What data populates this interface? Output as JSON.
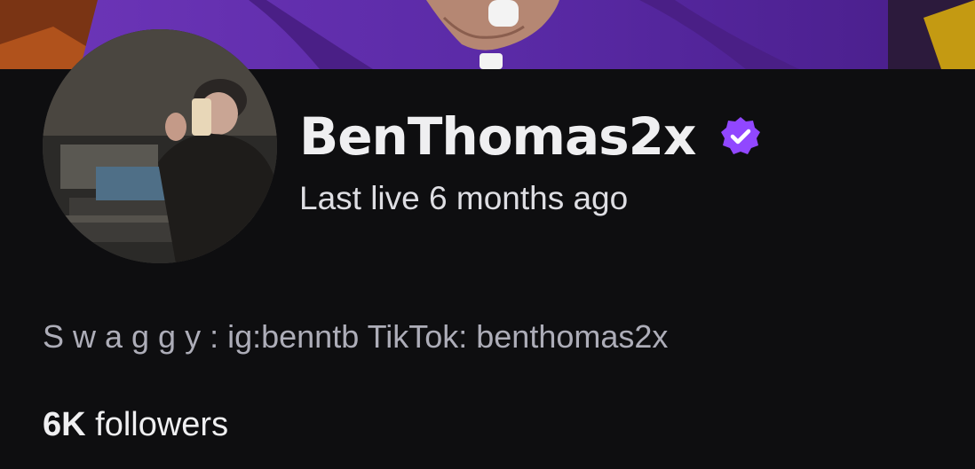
{
  "channel": {
    "name": "BenThomas2x",
    "verified": true,
    "last_live": "Last live 6 months ago",
    "bio": "S w a g g y : ig:benntb TikTok: benthomas2x",
    "followers_count": "6K",
    "followers_label": "followers"
  },
  "colors": {
    "background": "#0e0e10",
    "badge": "#9147ff",
    "text_primary": "#efeff1",
    "text_secondary": "#adadb8"
  },
  "icons": {
    "verified": "verified-badge-icon"
  }
}
